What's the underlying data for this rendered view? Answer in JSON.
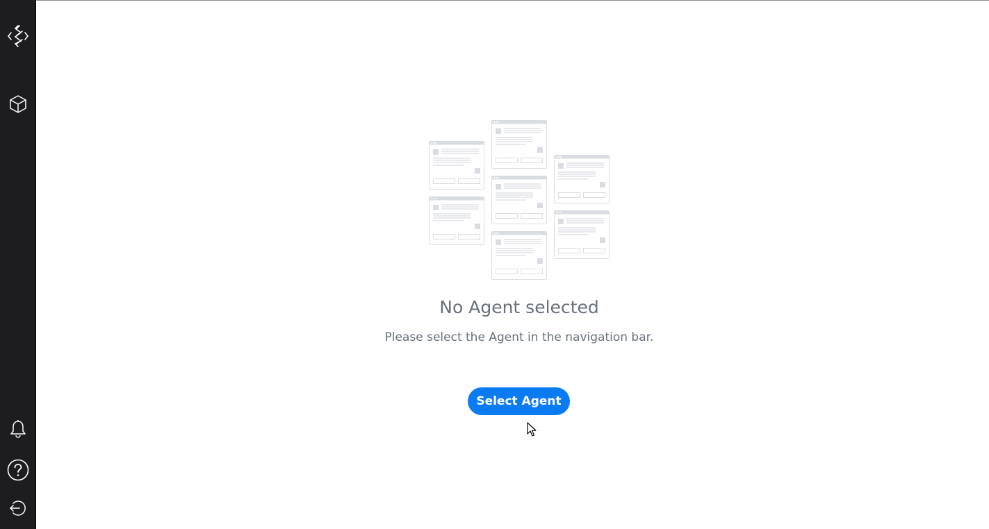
{
  "sidebar": {
    "items": [
      {
        "icon": "logo-icon"
      },
      {
        "icon": "cube-icon"
      },
      {
        "icon": "bell-icon"
      },
      {
        "icon": "help-icon"
      },
      {
        "icon": "logout-icon"
      }
    ]
  },
  "empty_state": {
    "title": "No Agent selected",
    "subtitle": "Please select the Agent in the navigation bar.",
    "button_label": "Select Agent"
  },
  "colors": {
    "sidebar_bg": "#1d1c1f",
    "primary": "#0b7bf3",
    "text_muted": "#68707c",
    "illustration": "#d9dce1"
  }
}
